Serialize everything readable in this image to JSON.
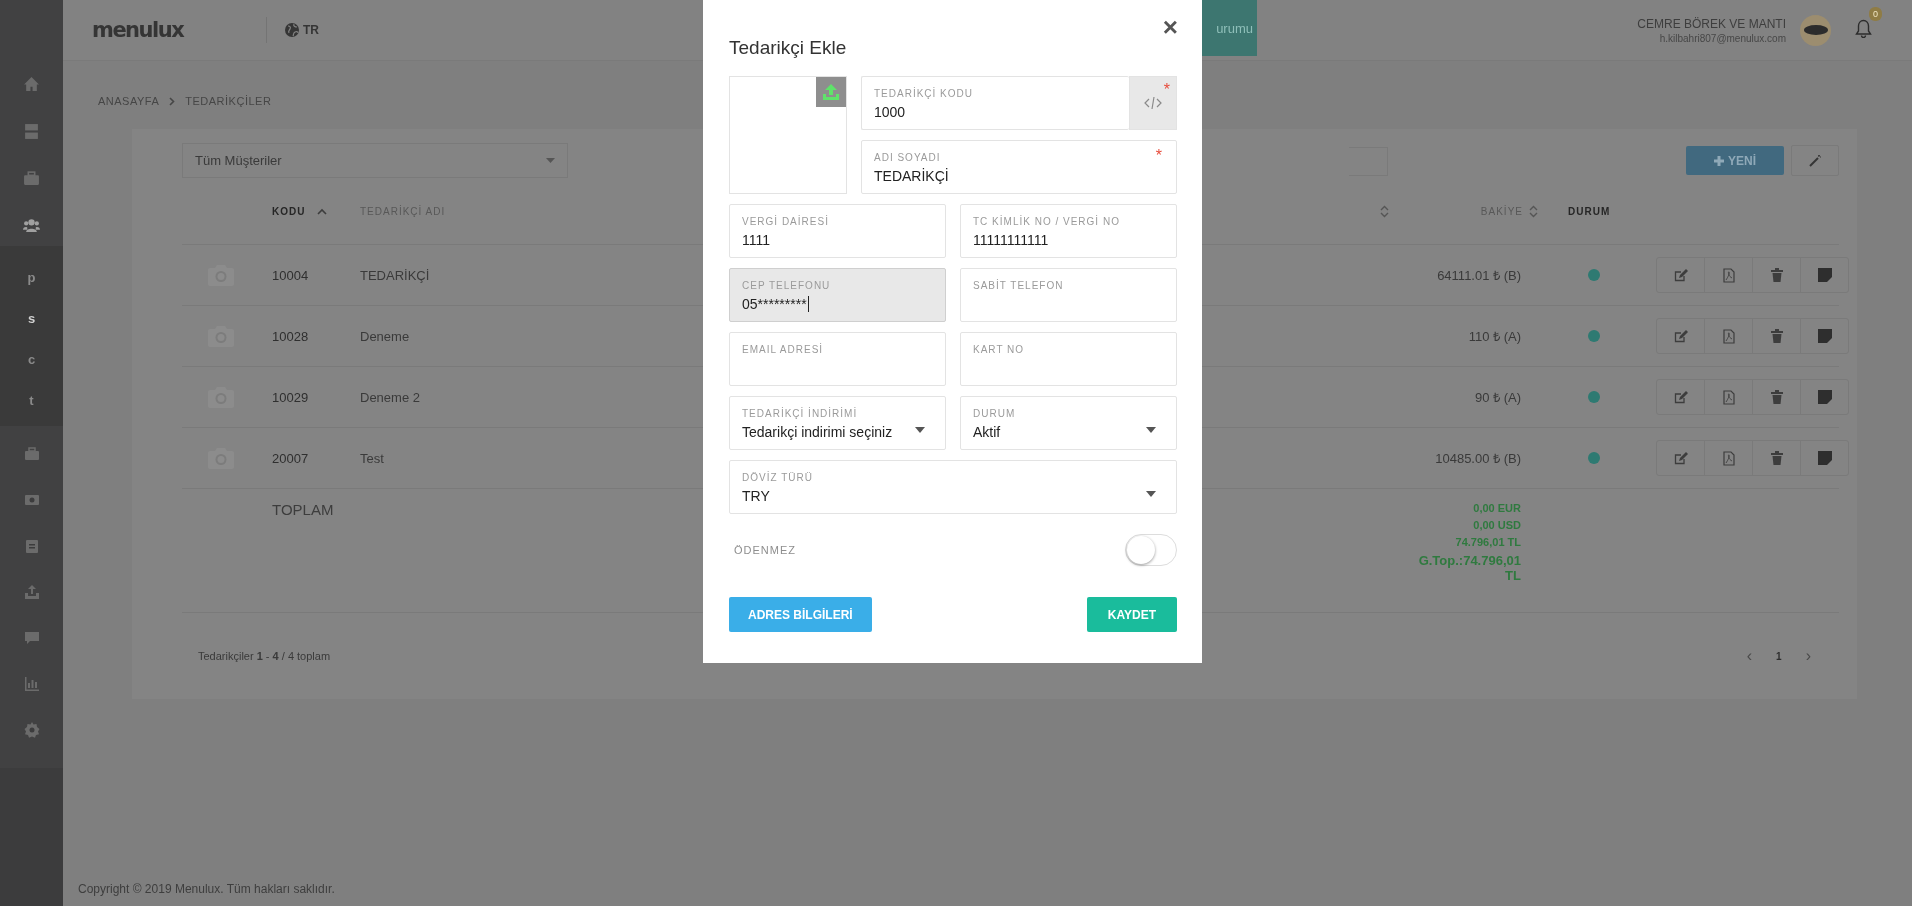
{
  "header": {
    "logo": "menulux",
    "language": "TR",
    "tab_fragment": "urumu",
    "user_name": "CEMRE BÖREK VE MANTI",
    "user_email": "h.kilbahri807@menulux.com",
    "notification_count": "0"
  },
  "sidebar": {
    "letters": [
      {
        "label": "p",
        "selected": false
      },
      {
        "label": "s",
        "selected": true
      },
      {
        "label": "c",
        "selected": false
      },
      {
        "label": "t",
        "selected": false
      }
    ]
  },
  "breadcrumb": [
    "ANASAYFA",
    "TEDARİKÇİLER"
  ],
  "filter": {
    "value": "Tüm Müşteriler"
  },
  "new_button": "YENİ",
  "table": {
    "columns": [
      {
        "label": "KODU",
        "sorted": true,
        "sortable": true,
        "muted": false
      },
      {
        "label": "TEDARİKÇİ ADI",
        "sorted": false,
        "sortable": false,
        "muted": true
      },
      {
        "sorted": false,
        "sortable": true
      },
      {
        "label": "BAKİYE",
        "sorted": false,
        "sortable": true,
        "muted": true
      },
      {
        "label": "DURUM",
        "sorted": false,
        "sortable": false,
        "muted": false
      }
    ],
    "rows": [
      {
        "code": "10004",
        "name": "TEDARİKÇİ",
        "balance": "64111.01 ₺ (B)",
        "active": true
      },
      {
        "code": "10028",
        "name": "Deneme",
        "balance": "110 ₺ (A)",
        "active": true
      },
      {
        "code": "10029",
        "name": "Deneme 2",
        "balance": "90 ₺ (A)",
        "active": true
      },
      {
        "code": "20007",
        "name": "Test",
        "balance": "10485.00 ₺ (B)",
        "active": true
      }
    ],
    "totals": {
      "label": "TOPLAM",
      "lines": [
        "0,00 EUR",
        "0,00 USD",
        "74.796,01 TL"
      ],
      "grand": "G.Top.:74.796,01 TL"
    }
  },
  "summary": "Tedarikçiler **1** - **4** / 4 toplam",
  "pagination": {
    "prev": "‹",
    "page": "1",
    "next": "›"
  },
  "copyright": "Copyright © 2019 Menulux. Tüm hakları saklıdır.",
  "modal": {
    "title": "Tedarikçi Ekle",
    "close": "×",
    "fields": [
      {
        "kind": "text",
        "label": "TEDARİKÇİ KODU",
        "value": "1000",
        "required_mark": "*",
        "generator": true,
        "focused": false
      },
      {
        "kind": "text",
        "label": "ADI SOYADI",
        "value": "TEDARİKÇİ",
        "required_mark": "*",
        "focused": false
      },
      {
        "kind": "text",
        "label": "VERGİ DAİRESİ",
        "value": "1111",
        "focused": false
      },
      {
        "kind": "text",
        "label": "TC KİMLİK NO / VERGİ NO",
        "value": "11111111111",
        "focused": false
      },
      {
        "kind": "text",
        "label": "CEP TELEFONU",
        "value": "05*********",
        "focused": true
      },
      {
        "kind": "text",
        "label": "SABİT TELEFON",
        "focused": false
      },
      {
        "kind": "text",
        "label": "EMAIL ADRESİ",
        "focused": false
      },
      {
        "kind": "text",
        "label": "KART NO",
        "focused": false
      },
      {
        "kind": "select",
        "label": "TEDARİKÇİ İNDİRİMİ",
        "value": "Tedarikçi indirimi seçiniz",
        "focused": false
      },
      {
        "kind": "select",
        "label": "DURUM",
        "value": "Aktif",
        "focused": false
      },
      {
        "kind": "select",
        "label": "DÖVİZ TÜRÜ",
        "value": "TRY",
        "focused": false,
        "wide": true
      }
    ],
    "toggle": {
      "label": "ÖDENMEZ",
      "on": false
    },
    "buttons": [
      {
        "label": "ADRES BİLGİLERİ",
        "kind": "secondary"
      },
      {
        "label": "KAYDET",
        "kind": "primary"
      }
    ]
  }
}
